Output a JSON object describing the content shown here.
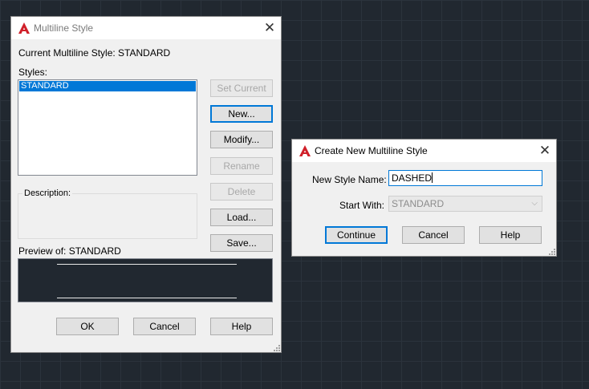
{
  "multiline_style": {
    "title": "Multiline Style",
    "current_label": "Current Multiline Style: STANDARD",
    "styles_label": "Styles:",
    "styles": [
      "STANDARD"
    ],
    "description_label": "Description:",
    "preview_label": "Preview of: STANDARD",
    "buttons": {
      "set_current": "Set Current",
      "new": "New...",
      "modify": "Modify...",
      "rename": "Rename",
      "delete": "Delete",
      "load": "Load...",
      "save": "Save...",
      "ok": "OK",
      "cancel": "Cancel",
      "help": "Help"
    }
  },
  "create_new": {
    "title": "Create New Multiline Style",
    "new_style_name_label": "New Style Name:",
    "new_style_name_value": "DASHED",
    "start_with_label": "Start With:",
    "start_with_value": "STANDARD",
    "buttons": {
      "continue": "Continue",
      "cancel": "Cancel",
      "help": "Help"
    }
  },
  "colors": {
    "accent": "#0078d7",
    "logo": "#d0202a",
    "canvas": "#212830"
  },
  "icons": [
    "autocad-logo-icon",
    "close-icon",
    "chevron-down-icon",
    "resize-grip-icon"
  ]
}
